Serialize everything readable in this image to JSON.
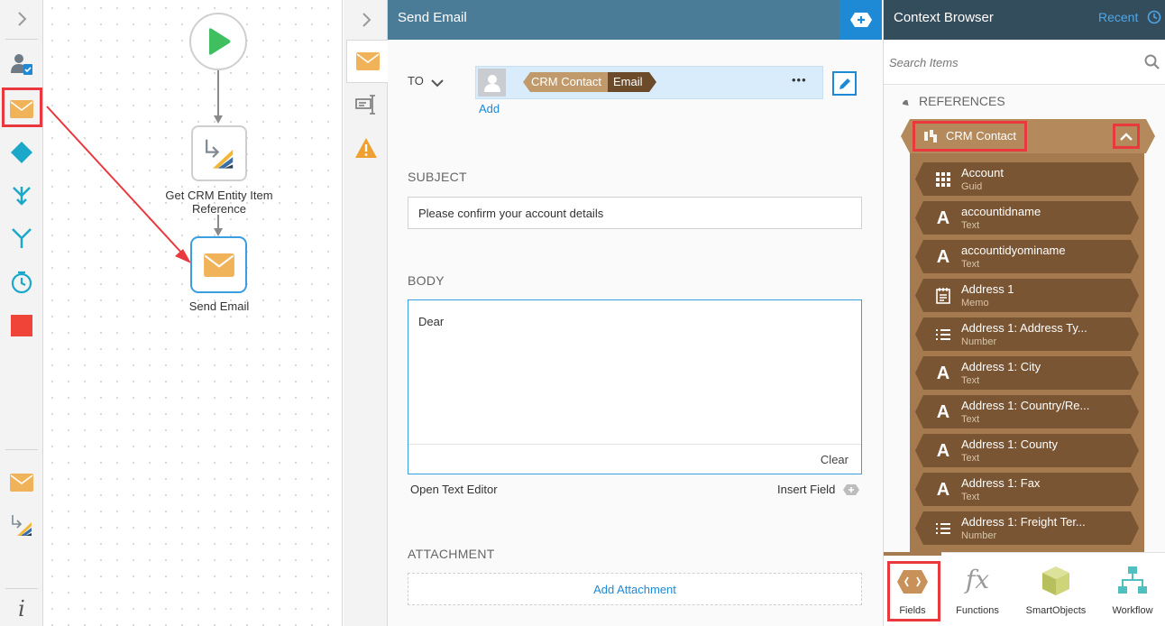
{
  "toolbox": {
    "items": [
      "expand",
      "user-task",
      "send-email",
      "decision",
      "split",
      "merge",
      "timer",
      "end"
    ],
    "recent": [
      "send-email",
      "get-crm-entity"
    ],
    "info_label": "i"
  },
  "canvas": {
    "nodes": {
      "start": "",
      "get_crm": "Get CRM Entity Item Reference",
      "send_email": "Send Email"
    }
  },
  "panel": {
    "title": "Send Email",
    "to_label": "TO",
    "add_link": "Add",
    "recipient_token_ref": "CRM Contact",
    "recipient_token_field": "Email",
    "more_label": "•••",
    "subject_label": "SUBJECT",
    "subject_value": "Please confirm your account details",
    "body_label": "BODY",
    "body_value": "Dear",
    "clear_label": "Clear",
    "open_text_editor": "Open Text Editor",
    "insert_field": "Insert Field",
    "attachment_label": "ATTACHMENT",
    "add_attachment": "Add Attachment"
  },
  "context_browser": {
    "title": "Context Browser",
    "recent_label": "Recent",
    "search_placeholder": "Search Items",
    "references_label": "REFERENCES",
    "reference_name": "CRM Contact",
    "items": [
      {
        "name": "Account",
        "type": "Guid",
        "icon": "grid-icon"
      },
      {
        "name": "accountidname",
        "type": "Text",
        "icon": "text-icon"
      },
      {
        "name": "accountidyominame",
        "type": "Text",
        "icon": "text-icon"
      },
      {
        "name": "Address 1",
        "type": "Memo",
        "icon": "memo-icon"
      },
      {
        "name": "Address 1: Address Ty...",
        "type": "Number",
        "icon": "number-icon"
      },
      {
        "name": "Address 1: City",
        "type": "Text",
        "icon": "text-icon"
      },
      {
        "name": "Address 1: Country/Re...",
        "type": "Text",
        "icon": "text-icon"
      },
      {
        "name": "Address 1: County",
        "type": "Text",
        "icon": "text-icon"
      },
      {
        "name": "Address 1: Fax",
        "type": "Text",
        "icon": "text-icon"
      },
      {
        "name": "Address 1: Freight Ter...",
        "type": "Number",
        "icon": "number-icon"
      }
    ],
    "tabs": [
      "Fields",
      "Functions",
      "SmartObjects",
      "Workflow"
    ]
  },
  "colors": {
    "header_blue": "#4a7c98",
    "accent_blue": "#1e8ad6",
    "reference_brown": "#7a5533",
    "reference_tan": "#b48a5c",
    "highlight_red": "#e9393e"
  }
}
